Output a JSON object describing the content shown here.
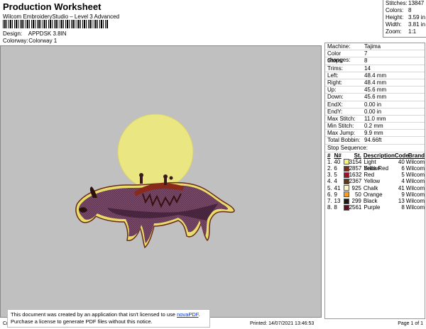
{
  "header": {
    "title": "Production Worksheet",
    "subtitle": "Wilcom EmbroideryStudio – Level 3 Advanced",
    "design_label": "Design:",
    "design_value": "APPDSK 3.8IN",
    "colorway_label": "Colorway:",
    "colorway_value": "Colorway 1"
  },
  "stats": [
    {
      "k": "Stitches:",
      "v": "13847"
    },
    {
      "k": "Colors:",
      "v": "8"
    },
    {
      "k": "Height:",
      "v": "3.59 in"
    },
    {
      "k": "Width:",
      "v": "3.81 in"
    },
    {
      "k": "Zoom:",
      "v": "1:1"
    }
  ],
  "props": [
    {
      "k": "Machine:",
      "v": "Tajima"
    },
    {
      "k": "Color changes:",
      "v": "7"
    },
    {
      "k": "Stops:",
      "v": "8"
    },
    {
      "k": "Trims:",
      "v": "14"
    },
    {
      "k": "Left:",
      "v": "48.4 mm"
    },
    {
      "k": "Right:",
      "v": "48.4 mm"
    },
    {
      "k": "Up:",
      "v": "45.6 mm"
    },
    {
      "k": "Down:",
      "v": "45.6 mm"
    },
    {
      "k": "EndX:",
      "v": "0.00 in"
    },
    {
      "k": "EndY:",
      "v": "0.00 in"
    },
    {
      "k": "Max Stitch:",
      "v": "11.0 mm"
    },
    {
      "k": "Min Stitch:",
      "v": "0.2 mm"
    },
    {
      "k": "Max Jump:",
      "v": "9.9 mm"
    },
    {
      "k": "Total Bobbin:",
      "v": "94.66ft"
    }
  ],
  "stop_sequence": {
    "title": "Stop Sequence:",
    "headers": {
      "num": "#",
      "n": "N#",
      "st": "St.",
      "desc": "Description",
      "code": "Code",
      "brand": "Brand"
    },
    "rows": [
      {
        "num": "1.",
        "n": "40",
        "color": "#f4f08a",
        "st": "3154",
        "desc": "Light Yellow",
        "code": "40",
        "brand": "Wilcom"
      },
      {
        "num": "2.",
        "n": "6",
        "color": "#7a2a1a",
        "st": "2857",
        "desc": "Brick Red",
        "code": "6",
        "brand": "Wilcom"
      },
      {
        "num": "3.",
        "n": "5",
        "color": "#a0102a",
        "st": "1632",
        "desc": "Red",
        "code": "5",
        "brand": "Wilcom"
      },
      {
        "num": "4.",
        "n": "4",
        "color": "#5a3a1a",
        "st": "2367",
        "desc": "Yellow",
        "code": "4",
        "brand": "Wilcom"
      },
      {
        "num": "5.",
        "n": "41",
        "color": "#fbf5c8",
        "st": "925",
        "desc": "Chalk",
        "code": "41",
        "brand": "Wilcom"
      },
      {
        "num": "6.",
        "n": "9",
        "color": "#f5a020",
        "st": "50",
        "desc": "Orange",
        "code": "9",
        "brand": "Wilcom"
      },
      {
        "num": "7.",
        "n": "13",
        "color": "#1a1a1a",
        "st": "299",
        "desc": "Black",
        "code": "13",
        "brand": "Wilcom"
      },
      {
        "num": "8.",
        "n": "8",
        "color": "#5a1020",
        "st": "2561",
        "desc": "Purple",
        "code": "8",
        "brand": "Wilcom"
      }
    ]
  },
  "footer": {
    "left": "Cr",
    "printed": "Printed: 14/07/2021 13:46:53",
    "page": "Page 1 of 1"
  },
  "notice": {
    "line1_pre": "This document was created by an application that isn't licensed to use ",
    "link": "novaPDF",
    "line1_post": ".",
    "line2": "Purchase a license to generate PDF files without this notice."
  }
}
